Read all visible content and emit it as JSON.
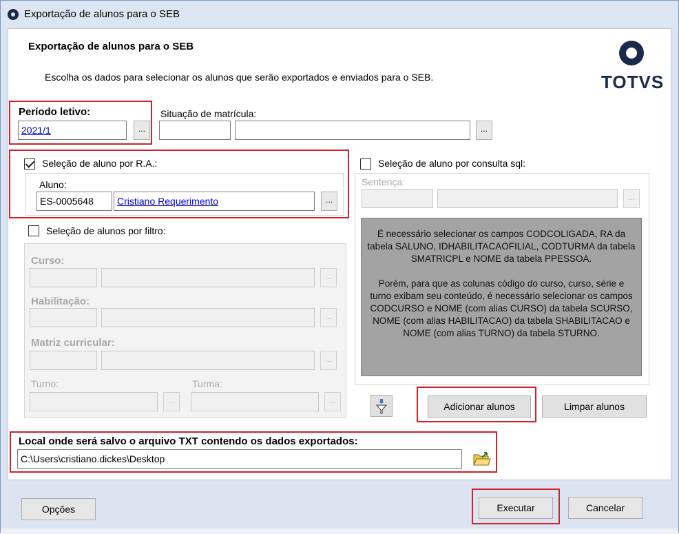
{
  "window": {
    "title": "Exportação de alunos para o SEB"
  },
  "header": {
    "title": "Exportação de alunos para o SEB",
    "description": "Escolha os dados para selecionar os alunos que serão exportados e enviados para o SEB.",
    "logo_text": "TOTVS"
  },
  "periodo": {
    "label": "Período letivo:",
    "value": "2021/1",
    "lookup": "..."
  },
  "situacao": {
    "label": "Situação de matrícula:",
    "code": "",
    "name": "",
    "lookup": "..."
  },
  "selecao_ra": {
    "label": "Seleção de aluno por R.A.:",
    "checked": true,
    "aluno_label": "Aluno:",
    "aluno_code": "ES-0005648",
    "aluno_name": "Cristiano Requerimento",
    "lookup": "..."
  },
  "selecao_sql": {
    "label": "Seleção de aluno por consulta sql:",
    "checked": false,
    "sentenca_label": "Sentença:",
    "lookup": "...",
    "notice_p1": "É necessário selecionar os campos CODCOLIGADA, RA da tabela SALUNO, IDHABILITACAOFILIAL, CODTURMA da tabela SMATRICPL e NOME da tabela PPESSOA.",
    "notice_p2": "Porém, para que as colunas código do curso, curso, série e turno exibam seu conteúdo, é necessário selecionar os campos CODCURSO e NOME (com alias CURSO) da tabela SCURSO, NOME (com alias HABILITACAO) da tabela SHABILITACAO e NOME (com alias TURNO) da tabela STURNO."
  },
  "selecao_filtro": {
    "label": "Seleção de alunos por filtro:",
    "checked": false,
    "curso_label": "Curso:",
    "habilitacao_label": "Habilitação:",
    "matriz_label": "Matriz curricular:",
    "turno_label": "Turno:",
    "turma_label": "Turma:",
    "lookup": "..."
  },
  "actions": {
    "add": "Adicionar alunos",
    "clear": "Limpar alunos"
  },
  "local": {
    "label": "Local onde será salvo o arquivo TXT contendo os dados exportados:",
    "value": "C:\\Users\\cristiano.dickes\\Desktop"
  },
  "footer": {
    "options": "Opções",
    "execute": "Executar",
    "cancel": "Cancelar"
  },
  "colors": {
    "highlight": "#d4202a",
    "link": "#0000d6",
    "brand": "#1b2a4a"
  }
}
